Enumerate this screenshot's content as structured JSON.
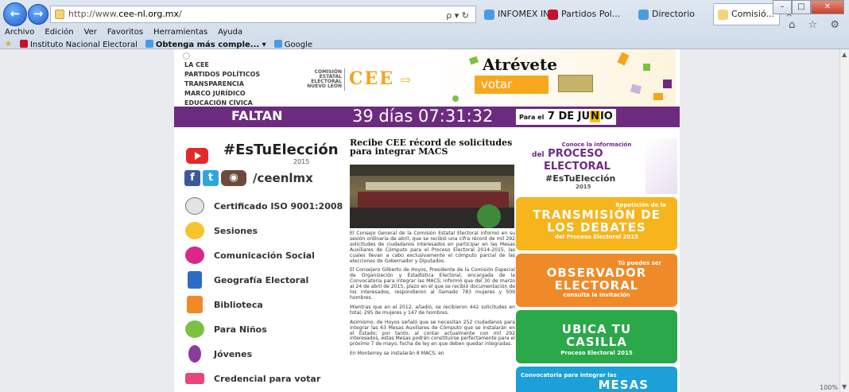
{
  "browser": {
    "back_label": "←",
    "forward_label": "→",
    "url_prefix": "http://www.",
    "url_domain": "cee-nl.org.mx",
    "url_suffix": "/",
    "address_tools": "ρ ▾ ↻",
    "tabs": [
      {
        "label": "INFOMEX INE",
        "color": "#4b9be0"
      },
      {
        "label": "Partidos Pol...",
        "color": "#c8102e"
      },
      {
        "label": "Directorio",
        "color": "#4b9be0"
      },
      {
        "label": "Comisió...",
        "color": "#f3d37a",
        "close": "×"
      }
    ],
    "window_controls": {
      "minimize": "–",
      "maximize": "□",
      "close": "✕"
    },
    "toolbar_icons": "⌂ ☆ ⚙",
    "menu": [
      "Archivo",
      "Edición",
      "Ver",
      "Favoritos",
      "Herramientas",
      "Ayuda"
    ],
    "favorites": [
      {
        "label": "Instituto Nacional Electoral",
        "color": "#c8102e"
      },
      {
        "label": "Obtenga más comple...",
        "color": "#4b9be0",
        "dropdown": "▾"
      },
      {
        "label": "Google",
        "color": "#4b9be0"
      }
    ]
  },
  "header": {
    "menu": [
      "LA CEE",
      "PARTIDOS POLÍTICOS",
      "TRANSPARENCIA",
      "MARCO JURÍDICO",
      "EDUCACIÓN CÍVICA"
    ],
    "logo_small": "COMISIÓN ESTATAL ELECTORAL NUEVO LEÓN",
    "logo_cee": "CEE",
    "banner_atrevete": "Atrévete",
    "banner_votar": "votar",
    "brand_purple": "#6d2b80",
    "brand_orange": "#f3a51b"
  },
  "countdown": {
    "faltan": "FALTAN",
    "time": "39 días 07:31:32",
    "date_prefix": "Para el",
    "date_main": "7 DE JU",
    "date_highlight": "N",
    "date_end": "IO"
  },
  "left": {
    "hashtag": "#EsTuElección",
    "hashtag_year": "2015",
    "social_handle": "/ceenlmx",
    "social": [
      {
        "label": "f",
        "color": "#3b5998"
      },
      {
        "label": "t",
        "color": "#2ea7e0"
      },
      {
        "label": "◉",
        "color": "#6b4a3a"
      }
    ],
    "nav": [
      {
        "label": "Certificado ISO 9001:2008",
        "color": "#9a9a9a"
      },
      {
        "label": "Sesiones",
        "color": "#f6c52d"
      },
      {
        "label": "Comunicación Social",
        "color": "#d8298a"
      },
      {
        "label": "Geografía Electoral",
        "color": "#2c6cc4"
      },
      {
        "label": "Biblioteca",
        "color": "#f08a28"
      },
      {
        "label": "Para Niños",
        "color": "#7cc242"
      },
      {
        "label": "Jóvenes",
        "color": "#8a3b9e"
      },
      {
        "label": "Credencial para votar",
        "color": "#e8457a"
      }
    ]
  },
  "article": {
    "title": "Recibe CEE récord de solicitudes para integrar MACS",
    "paragraphs": [
      "El Consejo General de la Comisión Estatal Electoral informó en su sesión ordinaria de abril, que se recibió una cifra récord de mil 292 solicitudes de ciudadanos interesados en participar en las Mesas Auxiliares de Cómputo para el Proceso Electoral 2014-2015, las cuales llevan a cabo exclusivamente el cómputo parcial de las elecciones de Gobernador y Diputados.",
      "El Consejero Gilberto de Hoyos, Presidente de la Comisión Especial de Organización y Estadística Electoral, encargada de la Convocatoria para integrar las MACS; informó que del 30 de marzo al 24 de abril de 2015, plazo en el que se recibió documentación de los interesados, respondieron al llamado 783 mujeres y 509 hombres.",
      "Mientras que en el 2012, añadió, se recibieron 442 solicitudes en total, 295 de mujeres y 147 de hombres.",
      "Asimismo, de Hoyos señaló que se necesitan 252 ciudadanos para integrar las 63 Mesas Auxiliares de Cómputo que se instalarán en el Estado; por tanto, al contar actualmente con mil 292 interesados, estas Mesas podrán constituirse perfectamente para el próximo 7 de mayo, fecha de ley en que deben quedar integradas.",
      "En Monterrey se instalarán 8 MACS; en"
    ]
  },
  "right": {
    "proceso": {
      "small": "Conoce la información",
      "del": "del",
      "big1": "PROCESO",
      "big2": "ELECTORAL",
      "tag": "#EsTuElección",
      "year": "2015"
    },
    "debates": {
      "small": "Repetición de la",
      "big1": "TRANSMISIÓN DE",
      "big2": "LOS DEBATES",
      "foot": "del Proceso Electoral 2015",
      "color": "#f6b51c"
    },
    "observador": {
      "small": "Tú puedes ser",
      "big1": "OBSERVADOR",
      "big2": "ELECTORAL",
      "foot": "consulta la invitación",
      "color": "#f08a28"
    },
    "casilla": {
      "big1": "UBICA TU",
      "big2": "CASILLA",
      "foot": "Proceso Electoral 2015",
      "color": "#2aa84a"
    },
    "mesas": {
      "small": "Convocatoria para integrar las",
      "big1": "MESAS",
      "color": "#1d9fd9"
    }
  },
  "status": {
    "zoom": "100%"
  }
}
